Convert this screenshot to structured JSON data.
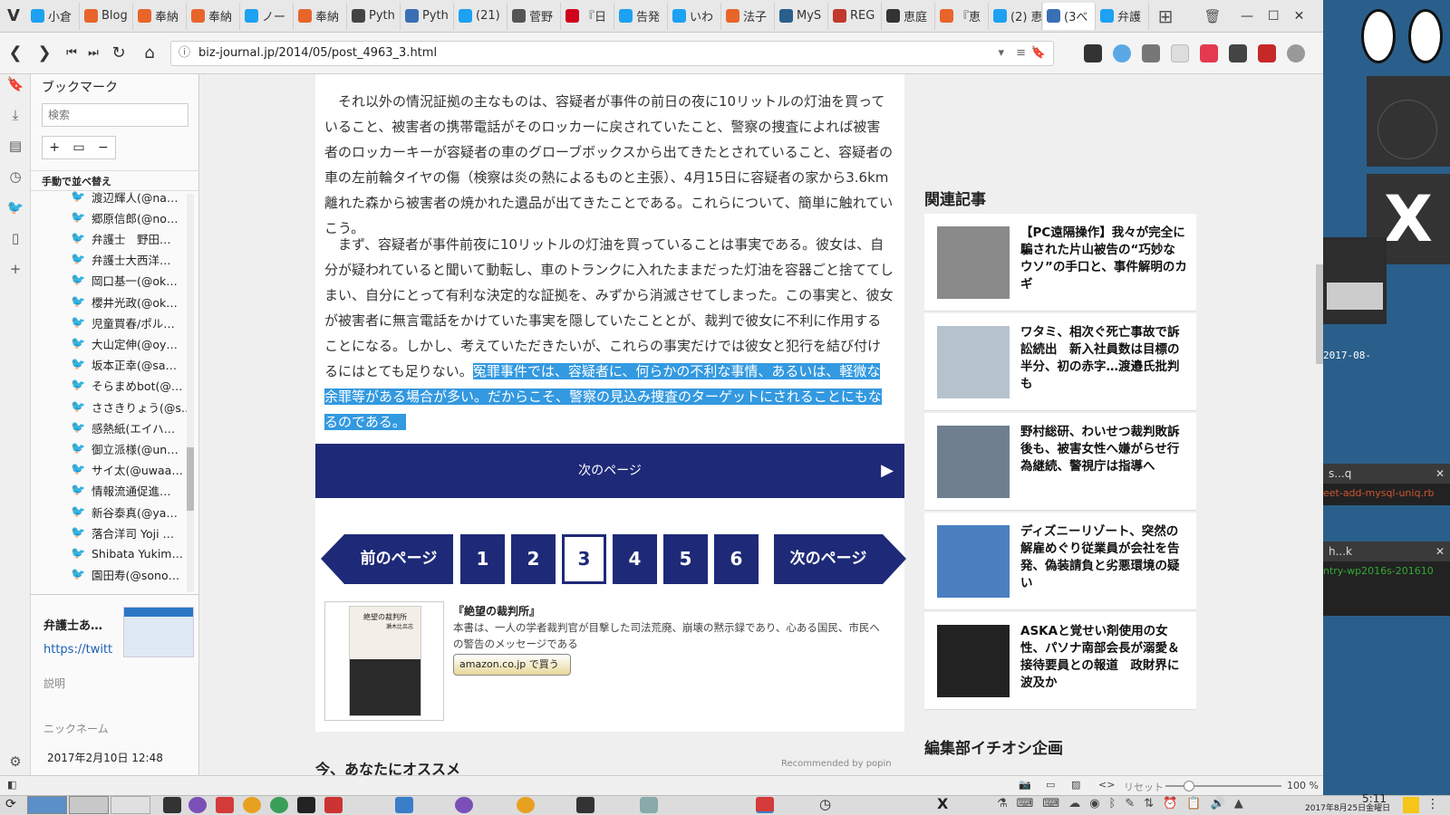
{
  "tabs": [
    {
      "label": "小倉",
      "color": "#1da1f2"
    },
    {
      "label": "Blog",
      "color": "#e8652a"
    },
    {
      "label": "奉納",
      "color": "#e8652a"
    },
    {
      "label": "奉納",
      "color": "#e8652a"
    },
    {
      "label": "ノー",
      "color": "#1da1f2"
    },
    {
      "label": "奉納",
      "color": "#e8652a"
    },
    {
      "label": "Pyth",
      "color": "#444444"
    },
    {
      "label": "Pyth",
      "color": "#3a6fb5"
    },
    {
      "label": "(21)",
      "color": "#1da1f2"
    },
    {
      "label": "菅野",
      "color": "#555555"
    },
    {
      "label": "『日",
      "color": "#d0021b"
    },
    {
      "label": "告発",
      "color": "#1da1f2"
    },
    {
      "label": "いわ",
      "color": "#1da1f2"
    },
    {
      "label": "法子",
      "color": "#e8652a"
    },
    {
      "label": "MyS",
      "color": "#2a5f8c"
    },
    {
      "label": "REG",
      "color": "#c0392b"
    },
    {
      "label": "恵庭",
      "color": "#333333"
    },
    {
      "label": "『恵",
      "color": "#e8652a"
    },
    {
      "label": "(2) 恵",
      "color": "#1da1f2"
    },
    {
      "label": "(3べ",
      "color": "#3a6fb5"
    },
    {
      "label": "弁護",
      "color": "#1da1f2"
    }
  ],
  "address": {
    "url": "biz-journal.jp/2014/05/post_4963_3.html"
  },
  "bookmarks": {
    "title": "ブックマーク",
    "search_placeholder": "検索",
    "sort_label": "手動で並べ替え",
    "items": [
      "渡辺輝人(@na…",
      "郷原信郎(@no…",
      "弁護士　野田…",
      "弁護士大西洋…",
      "岡口基一(@ok…",
      "櫻井光政(@ok…",
      "児童買春/ポル…",
      "大山定伸(@oy…",
      "坂本正幸(@sa…",
      "そらまめbot(@…",
      "ささきりょう(@s…",
      "感熱紙(エイハ…",
      "御立派様(@un…",
      "サイ太(@uwaa…",
      "情報流通促進…",
      "新谷泰真(@ya…",
      "落合洋司 Yoji …",
      "Shibata Yukim…",
      "園田寿(@sono…"
    ],
    "detail_title": "弁護士あ…",
    "detail_url": "https://twitt",
    "description_label": "説明",
    "nickname_label": "ニックネーム",
    "date": "2017年2月10日 12:48"
  },
  "article": {
    "para1": "それ以外の情況証拠の主なものは、容疑者が事件の前日の夜に10リットルの灯油を買っていること、被害者の携帯電話がそのロッカーに戻されていたこと、警察の捜査によれば被害者のロッカーキーが容疑者の車のグローブボックスから出てきたとされていること、容疑者の車の左前輪タイヤの傷（検察は炎の熱によるものと主張）、4月15日に容疑者の家から3.6km離れた森から被害者の焼かれた遺品が出てきたことである。これらについて、簡単に触れていこう。",
    "para2_normal": "まず、容疑者が事件前夜に10リットルの灯油を買っていることは事実である。彼女は、自分が疑われていると聞いて動転し、車のトランクに入れたままだった灯油を容器ごと捨ててしまい、自分にとって有利な決定的な証拠を、みずから消滅させてしまった。この事実と、彼女が被害者に無言電話をかけていた事実を隠していたこととが、裁判で彼女に不利に作用することになる。しかし、考えていただきたいが、これらの事実だけでは彼女と犯行を結び付けるにはとても足りない。",
    "para2_highlight": "冤罪事件では、容疑者に、何らかの不利な事情、あるいは、軽微な余罪等がある場合が多い。だからこそ、警察の見込み捜査のターゲットにされることにもなるのである。",
    "next_page": "次のページ",
    "prev_btn": "前のページ",
    "next_btn": "次のページ",
    "pages": [
      "1",
      "2",
      "3",
      "4",
      "5",
      "6"
    ],
    "current_page": "3",
    "book_title": "『絶望の裁判所』",
    "book_desc": "本書は、一人の学者裁判官が目撃した司法荒廃、崩壊の黙示録であり、心ある国民、市民への警告のメッセージである",
    "amazon_label": "amazon.co.jp で買う",
    "book_cover_title": "絶望の裁判所",
    "book_cover_author": "瀬木比呂志",
    "recommend_title": "今、あなたにオススメ",
    "recommend_by": "Recommended by popin"
  },
  "related": {
    "title": "関連記事",
    "items": [
      "【PC遠隔操作】我々が完全に騙された片山被告の“巧妙なウソ”の手口と、事件解明のカギ",
      "ワタミ、相次ぐ死亡事故で訴訟続出　新入社員数は目標の半分、初の赤字…渡邉氏批判も",
      "野村総研、わいせつ裁判敗訴後も、被害女性へ嫌がらせ行為継続、警視庁は指導へ",
      "ディズニーリゾート、突然の解雇めぐり従業員が会社を告発、偽装請負と劣悪環境の疑い",
      "ASKAと覚せい剤使用の女性、パソナ南部会長が溺愛＆接待要員との報道　政財界に波及か"
    ],
    "section2": "編集部イチオシ企画"
  },
  "statusbar": {
    "reset": "リセット",
    "zoom": "100 %"
  },
  "desktop": {
    "win1_title": "s...q",
    "win1_text": "eet-add-mysql-uniq.rb",
    "win2_title": "h...k",
    "win2_text": "ntry-wp2016s-201610",
    "date_text": "2017-08-"
  },
  "clock": {
    "time": "5:11",
    "date": "2017年8月25日金曜日"
  }
}
